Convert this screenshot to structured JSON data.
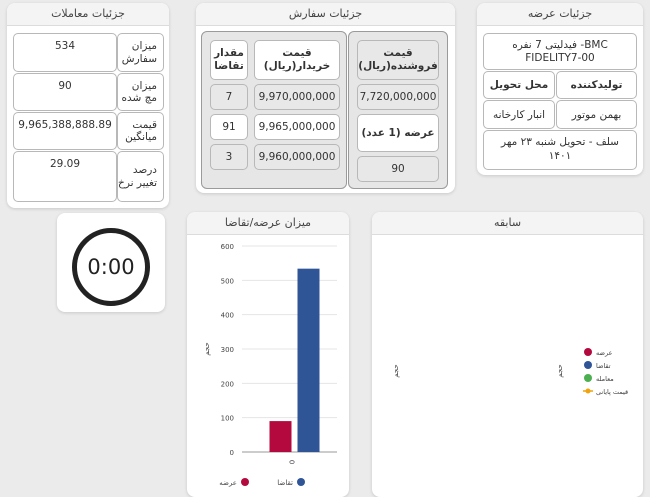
{
  "trade_details": {
    "title": "جزئیات معاملات",
    "rows": [
      {
        "label": "میزان سفارش",
        "value": "534"
      },
      {
        "label": "میزان مچ شده",
        "value": "90"
      },
      {
        "label": "قیمت میانگین",
        "value": "9,965,388,888.89"
      },
      {
        "label": "درصد تغییر نرخ",
        "value": "29.09"
      }
    ]
  },
  "order_details": {
    "title": "جزئیات سفارش",
    "buy_headers": {
      "qty": "مقدار تقاضا",
      "price": "قیمت خریدار(ریال)"
    },
    "buy_rows": [
      {
        "qty": "7",
        "price": "9,970,000,000"
      },
      {
        "qty": "91",
        "price": "9,965,000,000"
      },
      {
        "qty": "3",
        "price": "9,960,000,000"
      }
    ],
    "sell_header": "قیمت فروشنده(ریال)",
    "sell_price": "7,720,000,000",
    "supply_header": "عرضه (1 عدد)",
    "supply_qty": "90"
  },
  "supply_details": {
    "title": "جزئیات عرضه",
    "product": "فیدلیتی 7 نفره -BMC FIDELITY7-00",
    "producer_label": "تولیدکننده",
    "delivery_label": "محل تحویل",
    "producer": "بهمن موتور",
    "delivery": "انبار کارخانه",
    "settlement": "سلف - تحویل شنبه ۲۳ مهر ۱۴۰۱"
  },
  "timer": {
    "value": "0:00"
  },
  "chart_data": [
    {
      "type": "bar",
      "title": "میزان عرضه/تقاضا",
      "ylabel": "حجم",
      "categories": [
        "0"
      ],
      "series": [
        {
          "name": "عرضه",
          "values": [
            90
          ],
          "color": "#b3093f"
        },
        {
          "name": "تقاضا",
          "values": [
            534
          ],
          "color": "#2f5597"
        }
      ],
      "ylim": [
        0,
        600
      ],
      "yticks": [
        "0",
        "100",
        "200",
        "300",
        "400",
        "500",
        "600"
      ],
      "grid": true,
      "legend": "bottom"
    },
    {
      "type": "line",
      "title": "سابقه",
      "ylabel": "حجم",
      "series": [
        {
          "name": "عرضه",
          "values": [],
          "color": "#b3093f"
        },
        {
          "name": "تقاضا",
          "values": [],
          "color": "#2f5597"
        },
        {
          "name": "معامله",
          "values": [],
          "color": "#4caf50"
        },
        {
          "name": "قیمت پایانی",
          "values": [],
          "color": "#f0a30a"
        }
      ],
      "legend": "center"
    }
  ]
}
